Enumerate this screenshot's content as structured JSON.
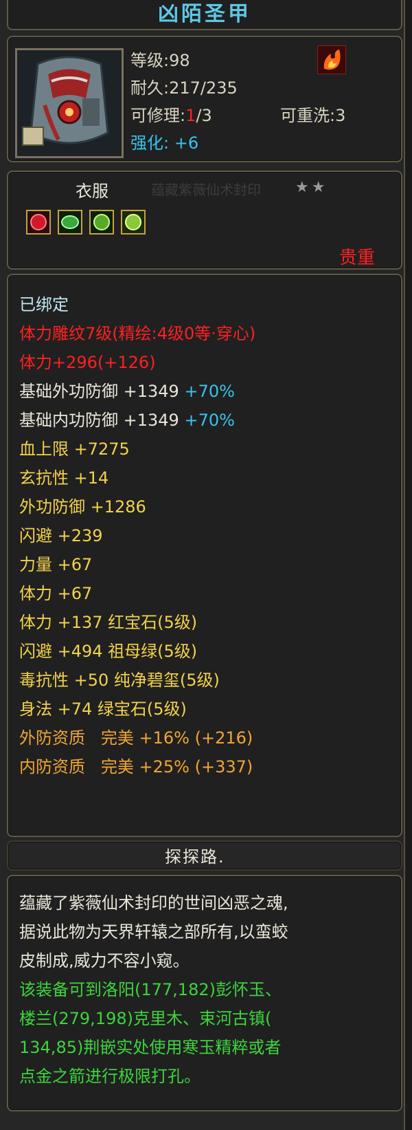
{
  "item": {
    "name": "凶陌圣甲",
    "level_label": "等级",
    "level_value": ":98",
    "durability_label": "耐久",
    "durability_value": ":217/235",
    "repair_label": "可修理",
    "repair_sep": ":",
    "repair_used": "1",
    "repair_total": "/3",
    "rewash_label": "可重洗",
    "rewash_value": ":3",
    "enhance_label": "强化:",
    "enhance_value": "+6",
    "type": "衣服",
    "stars_hidden_text": "蕴藏紫薇仙术封印",
    "stars": "★★",
    "quality": "贵重",
    "icons": {
      "portrait": "armor-portrait-icon",
      "corner": "fire-emblem-icon"
    },
    "gem_slots": [
      "ruby-gem-icon",
      "emerald-gem-icon",
      "emerald-gem-icon",
      "jade-gem-icon"
    ]
  },
  "attributes": {
    "bound": "已绑定",
    "carving": "体力雕纹7级(精绘:4级0等·穿心)",
    "stamina_bonus": "体力+296(+126)",
    "lines": [
      {
        "label": "基础外功防御",
        "value": "+1349",
        "extra": "+70%"
      },
      {
        "label": "基础内功防御",
        "value": "+1349",
        "extra": "+70%"
      }
    ],
    "yellow_lines": [
      "血上限 +7275",
      "玄抗性 +14",
      "外功防御 +1286",
      "闪避 +239",
      "力量 +67",
      "体力 +67",
      "体力 +137 红宝石(5级)",
      "闪避 +494 祖母绿(5级)",
      "毒抗性 +50 纯净碧玺(5级)",
      "身法 +74 绿宝石(5级)"
    ],
    "quality_lines": [
      "外防资质   完美 +16% (+216)",
      "内防资质   完美 +25% (+337)"
    ]
  },
  "owner": "探探路.",
  "description": {
    "lore": [
      "蕴藏了紫薇仙术封印的世间凶恶之魂,",
      "据说此物为天界轩辕之部所有,以蛮蛟",
      "皮制成,威力不容小窥。"
    ],
    "hint": [
      "该装备可到洛阳(177,182)彭怀玉、",
      "楼兰(279,198)克里木、束河古镇(",
      "134,85)荆嵌实处使用寒玉精粹或者",
      "点金之箭进行极限打孔。"
    ]
  },
  "colors": {
    "title": "#5ec8e6",
    "red": "#ff2020",
    "cyan": "#39c3ee",
    "yellow": "#f2d24a",
    "orange": "#f0a632",
    "green": "#3cd53c",
    "border": "#5f5944"
  }
}
